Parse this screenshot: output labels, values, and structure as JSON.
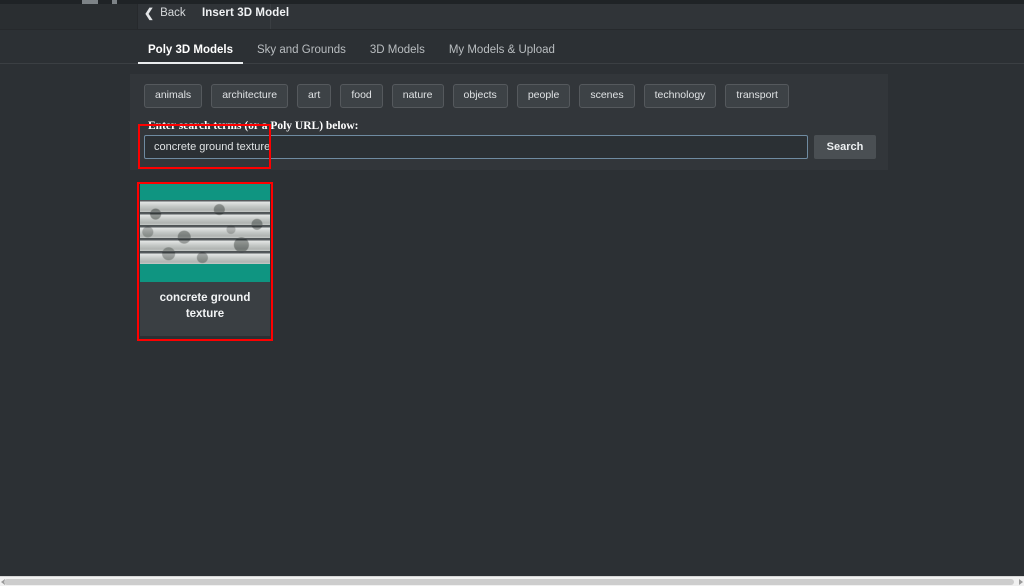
{
  "header": {
    "back_label": "Back",
    "back_icon": "chevron-left-icon",
    "title": "Insert 3D Model"
  },
  "tabs": [
    {
      "label": "Poly 3D Models",
      "active": true
    },
    {
      "label": "Sky and Grounds",
      "active": false
    },
    {
      "label": "3D Models",
      "active": false
    },
    {
      "label": "My Models & Upload",
      "active": false
    }
  ],
  "categories": [
    {
      "label": "animals"
    },
    {
      "label": "architecture"
    },
    {
      "label": "art"
    },
    {
      "label": "food"
    },
    {
      "label": "nature"
    },
    {
      "label": "objects"
    },
    {
      "label": "people"
    },
    {
      "label": "scenes"
    },
    {
      "label": "technology"
    },
    {
      "label": "transport"
    }
  ],
  "search": {
    "label": "Enter search terms (or a Poly URL) below:",
    "value": "concrete ground texture",
    "placeholder": "",
    "button_label": "Search"
  },
  "results": [
    {
      "title": "concrete ground texture",
      "thumbnail_background": "#0f9581",
      "thumbnail_subject": "concrete-slab-texture"
    }
  ],
  "colors": {
    "page_background": "#2c3034",
    "panel_background": "#32363a",
    "header_background": "#303438",
    "card_background": "#3a3f43",
    "thumbnail_teal": "#0f9581",
    "input_border": "#6f8ba1",
    "highlight": "#fe0000",
    "tab_active_underline": "#e9ecee"
  },
  "annotations": [
    {
      "name": "search-input-highlight"
    },
    {
      "name": "result-card-highlight"
    }
  ],
  "scrollbar": {
    "orientation": "horizontal",
    "left_arrow": "triangle-left-icon",
    "right_arrow": "triangle-right-icon"
  }
}
